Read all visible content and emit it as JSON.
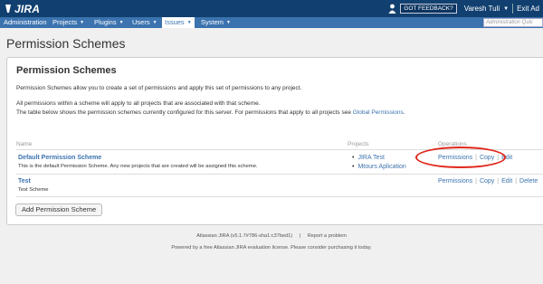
{
  "header": {
    "logo_text": "JIRA",
    "feedback_label": "GOT FEEDBACK?",
    "user_name": "Varesh Tuli",
    "exit_label": "Exit Ad",
    "colors": {
      "header_bg": "#114070",
      "nav_bg": "#3b73af"
    }
  },
  "nav": {
    "items": [
      {
        "label": "Administration",
        "has_menu": false
      },
      {
        "label": "Projects",
        "has_menu": true
      },
      {
        "label": "Plugins",
        "has_menu": true
      },
      {
        "label": "Users",
        "has_menu": true
      },
      {
        "label": "Issues",
        "has_menu": true,
        "active": true
      },
      {
        "label": "System",
        "has_menu": true
      }
    ],
    "search_placeholder": "Administration Quic"
  },
  "page": {
    "title": "Permission Schemes"
  },
  "panel": {
    "title": "Permission Schemes",
    "intro": "Permission Schemes allow you to create a set of permissions and apply this set of permissions to any project.",
    "note_line1": "All permissions within a scheme will apply to all projects that are associated with that scheme.",
    "note_line2_prefix": "The table below shows the permission schemes currently configured for this server. For permissions that apply to all projects see ",
    "note_line2_link": "Global Permissions",
    "note_line2_suffix": "."
  },
  "table": {
    "headers": {
      "name": "Name",
      "projects": "Projects",
      "operations": "Operations"
    },
    "rows": [
      {
        "name": "Default Permission Scheme",
        "description": "This is the default Permission Scheme. Any new projects that are created will be assigned this scheme.",
        "projects": [
          "JIRA Test",
          "Mtours Aplication"
        ],
        "operations": {
          "permissions": "Permissions",
          "copy": "Copy",
          "edit": "Edit"
        }
      },
      {
        "name": "Test",
        "description": "Test Scheme",
        "projects": [],
        "operations": {
          "permissions": "Permissions",
          "copy": "Copy",
          "edit": "Edit",
          "delete": "Delete"
        }
      }
    ]
  },
  "add_button_label": "Add Permission Scheme",
  "footer": {
    "version_text": "Atlassian JIRA (v5.1.7#786-sha1:c37bed1)",
    "divider": "|",
    "report_link": "Report a problem",
    "license_text": "Powered by a free Atlassian JIRA evaluation license. Please consider purchasing it today."
  }
}
